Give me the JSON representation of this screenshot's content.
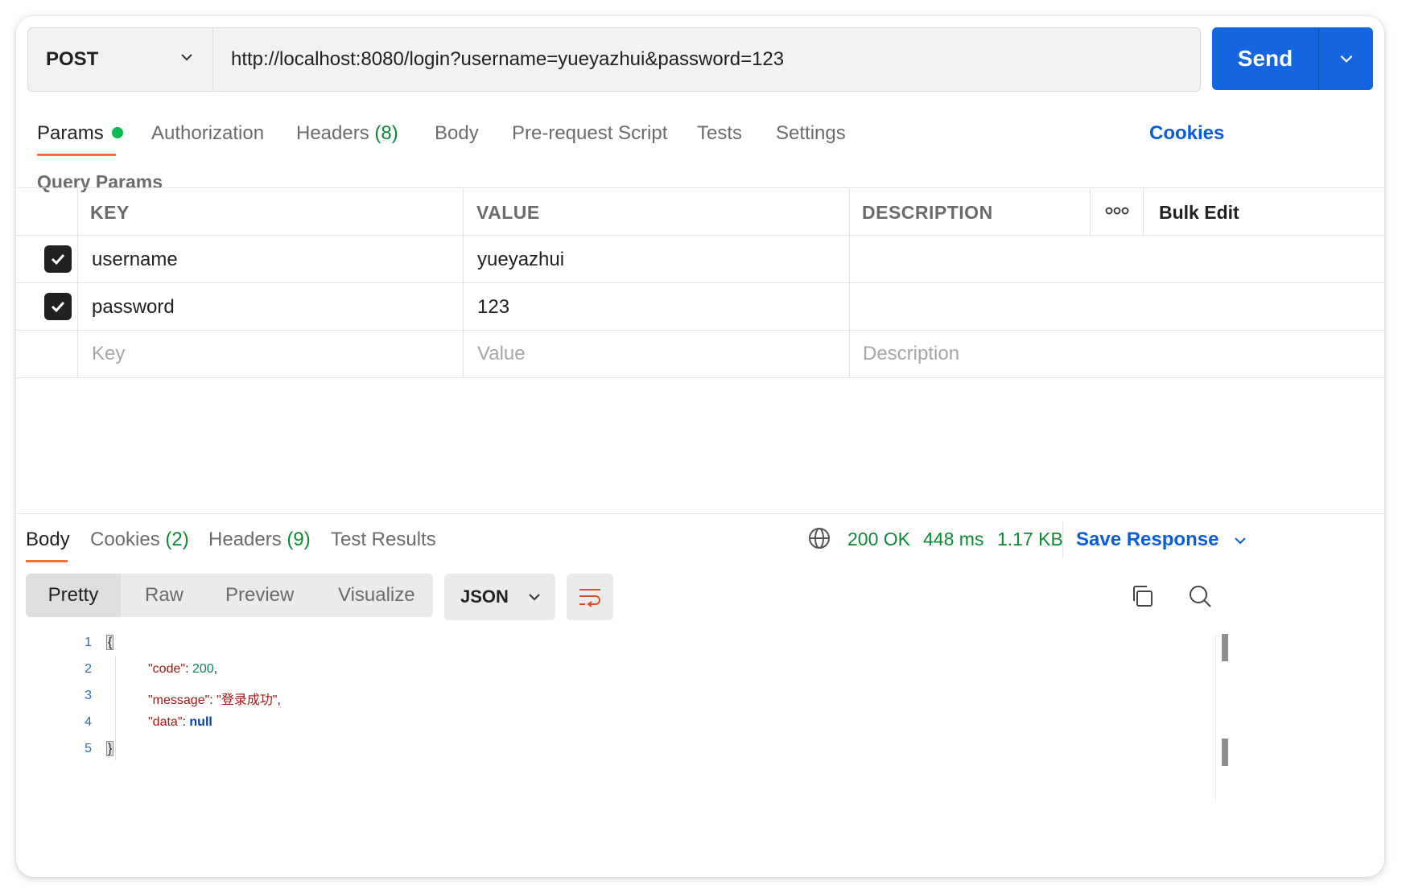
{
  "request": {
    "method": "POST",
    "url": "http://localhost:8080/login?username=yueyazhui&password=123",
    "send_label": "Send"
  },
  "request_tabs": {
    "params": "Params",
    "authorization": "Authorization",
    "headers": "Headers",
    "headers_count": "(8)",
    "body": "Body",
    "prerequest": "Pre-request Script",
    "tests": "Tests",
    "settings": "Settings",
    "cookies": "Cookies"
  },
  "query_params": {
    "title": "Query Params",
    "headers": {
      "key": "KEY",
      "value": "VALUE",
      "description": "DESCRIPTION",
      "more": "ooo",
      "bulk_edit": "Bulk Edit"
    },
    "rows": [
      {
        "checked": true,
        "key": "username",
        "value": "yueyazhui",
        "description": ""
      },
      {
        "checked": true,
        "key": "password",
        "value": "123",
        "description": ""
      }
    ],
    "placeholders": {
      "key": "Key",
      "value": "Value",
      "description": "Description"
    }
  },
  "response_tabs": {
    "body": "Body",
    "cookies": "Cookies",
    "cookies_count": "(2)",
    "headers": "Headers",
    "headers_count": "(9)",
    "test_results": "Test Results"
  },
  "response_status": {
    "status": "200 OK",
    "time": "448 ms",
    "size": "1.17 KB",
    "save_label": "Save Response"
  },
  "view_modes": [
    "Pretty",
    "Raw",
    "Preview",
    "Visualize"
  ],
  "format": "JSON",
  "code_lines": [
    {
      "num": "1",
      "text": "{"
    },
    {
      "num": "2",
      "key": "\"code\"",
      "sep": ": ",
      "val": "200",
      "val_type": "num",
      "tail": ","
    },
    {
      "num": "3",
      "key": "\"message\"",
      "sep": ": ",
      "val": "\"登录成功\"",
      "val_type": "str",
      "tail": ","
    },
    {
      "num": "4",
      "key": "\"data\"",
      "sep": ": ",
      "val": "null",
      "val_type": "kw",
      "tail": ""
    },
    {
      "num": "5",
      "text": "}"
    }
  ],
  "colors": {
    "accent": "#1565e0",
    "tab_underline": "#ff6c37",
    "success": "#0c8a34",
    "link": "#0b5cd5"
  }
}
